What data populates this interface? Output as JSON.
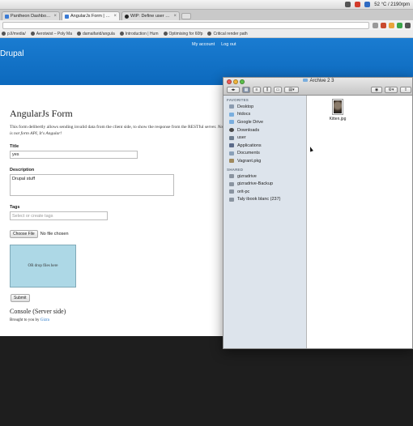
{
  "menubar": {
    "status_text": "52 °C / 2190rpm"
  },
  "browser": {
    "tabs": [
      {
        "label": "Pantheon Dashboard",
        "active": false,
        "icon": "pantheon-icon"
      },
      {
        "label": "AngularJs Form | Headles",
        "active": true,
        "icon": "drupal-icon"
      },
      {
        "label": "WIP: Define user hierarch",
        "active": false,
        "icon": "github-icon"
      }
    ],
    "bookmarks": [
      {
        "label": "p.ll/media/",
        "icon": "link-icon"
      },
      {
        "label": "Aerotwist – Poly Ma",
        "icon": "aerotwist-icon"
      },
      {
        "label": "damaifarid/angula",
        "icon": "github-icon"
      },
      {
        "label": "Introduction | Hum",
        "icon": "doc-icon"
      },
      {
        "label": "Optimising for 60fp",
        "icon": "chrome-icon"
      },
      {
        "label": "Critical render path",
        "icon": "star-icon"
      }
    ]
  },
  "drupal": {
    "site_name": "Drupal",
    "my_account": "My account",
    "log_out": "Log out"
  },
  "form": {
    "title": "AngularJs Form",
    "intro_plain": "This form delibertly allows sending invalid data from the client side, to show the response from the RESTful server.",
    "intro_italic": "Note that this form is not form API, It's Angular!",
    "title_label": "Title",
    "title_value": "yes",
    "description_label": "Description",
    "description_value": "Drupal stuff",
    "tags_label": "Tags",
    "tags_placeholder": "Select or create tags",
    "choose_file_label": "Choose File",
    "no_file_text": "No file chosen",
    "dropzone_text": "OR drop files here",
    "submit_label": "Submit",
    "console_title": "Console (Server side)",
    "credit_prefix": "Brought to you by",
    "credit_link": "Gizra"
  },
  "finder": {
    "window_title": "Archive 2 3",
    "favorites_heading": "FAVORITES",
    "favorites": [
      {
        "label": "Desktop",
        "icon": "desktop-icon",
        "color": "#8a9bb0"
      },
      {
        "label": "htdocs",
        "icon": "folder-icon",
        "color": "#7aaede"
      },
      {
        "label": "Google Drive",
        "icon": "folder-icon",
        "color": "#7aaede"
      },
      {
        "label": "Downloads",
        "icon": "downloads-icon",
        "color": "#4a4a4a"
      },
      {
        "label": "user",
        "icon": "home-icon",
        "color": "#6c7c8e"
      },
      {
        "label": "Applications",
        "icon": "applications-icon",
        "color": "#5b6b8a"
      },
      {
        "label": "Documents",
        "icon": "documents-icon",
        "color": "#8aa0b8"
      },
      {
        "label": "Vagrant.pkg",
        "icon": "package-icon",
        "color": "#a08a5e"
      }
    ],
    "shared_heading": "SHARED",
    "shared": [
      {
        "label": "gizradrive",
        "icon": "computer-icon",
        "color": "#8a94a0"
      },
      {
        "label": "gizradrive-Backup",
        "icon": "computer-icon",
        "color": "#8a94a0"
      },
      {
        "label": "orit-pc",
        "icon": "computer-icon",
        "color": "#8a94a0"
      },
      {
        "label": "Taly ibook blanc (237)",
        "icon": "computer-icon",
        "color": "#8a94a0"
      }
    ],
    "file": {
      "name": "Kitten.jpg"
    }
  }
}
